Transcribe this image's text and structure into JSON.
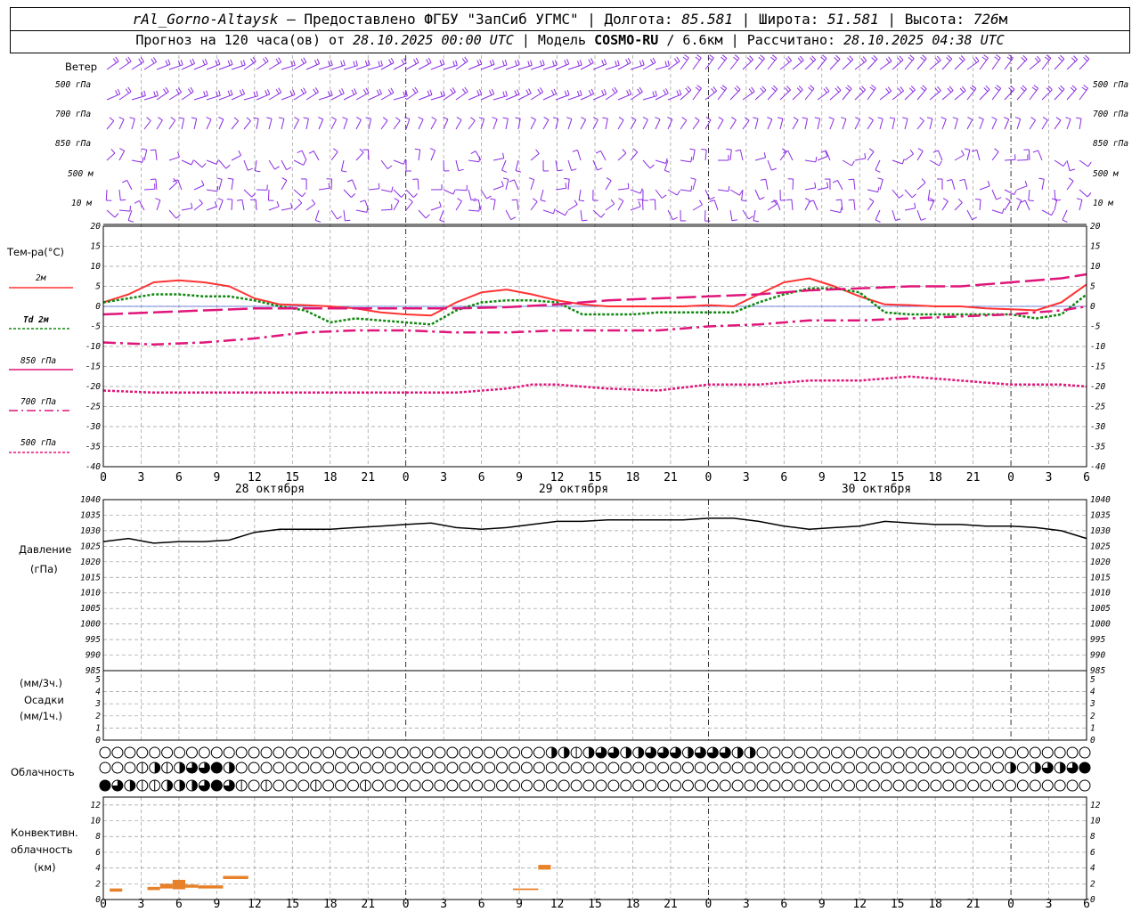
{
  "header": {
    "station": "rAl_Gorno-Altaysk",
    "provider": "Предоставлено ФГБУ \"ЗапСиб УГМС\"",
    "lon_label": "Долгота:",
    "lon_value": "85.581",
    "lat_label": "Широта:",
    "lat_value": "51.581",
    "alt_label": "Высота:",
    "alt_value": "726",
    "alt_unit": "м",
    "forecast_label": "Прогноз на 120 часа(ов) от",
    "forecast_start": "28.10.2025 00:00 UTC",
    "model_label": "Модель",
    "model_name": "COSMO-RU",
    "model_res": "/ 6.6км",
    "computed_label": "Рассчитано:",
    "computed_time": "28.10.2025 04:38 UTC"
  },
  "colors": {
    "wind": "#8a2be2",
    "t2m": "#ff3333",
    "td2m": "#118811",
    "upper": "#e0157a",
    "pressure": "#000000",
    "conv": "#e8822a",
    "grid": "#999999",
    "zero_line": "#4a5fd6"
  },
  "panels": {
    "wind_title": "Ветер",
    "wind_levels": [
      "500 гПа",
      "700 гПа",
      "850 гПа",
      "500 м",
      "10 м"
    ],
    "temp_title": "Тем-ра(°С)",
    "pressure_title": "Давление",
    "pressure_unit": "(гПа)",
    "precip_unit1": "(мм/3ч.)",
    "precip_title": "Осадки",
    "precip_unit2": "(мм/1ч.)",
    "cloud_title": "Облачность",
    "conv_title1": "Конвективн.",
    "conv_title2": "облачность",
    "conv_unit": "(км)",
    "dates": [
      "28 октября",
      "29 октября",
      "30 октября"
    ]
  },
  "chart_data": [
    {
      "type": "line",
      "id": "temperature",
      "ylim": [
        -40,
        20
      ],
      "yticks": [
        20,
        15,
        10,
        5,
        0,
        -5,
        -10,
        -15,
        -20,
        -25,
        -30,
        -35,
        -40
      ],
      "x_hours": [
        0,
        3,
        6,
        9,
        12,
        15,
        18,
        21,
        24,
        27,
        30,
        33,
        36,
        39,
        42,
        45,
        48,
        51,
        54,
        57,
        60,
        63,
        66,
        69,
        72,
        75,
        78
      ],
      "x_tick_labels": [
        "0",
        "3",
        "6",
        "9",
        "12",
        "15",
        "18",
        "21",
        "0",
        "3",
        "6",
        "9",
        "12",
        "15",
        "18",
        "21",
        "0",
        "3",
        "6",
        "9",
        "12",
        "15",
        "18",
        "21",
        "0",
        "3",
        "6"
      ],
      "series": [
        {
          "name": "2м",
          "x": [
            0,
            2,
            4,
            6,
            8,
            10,
            12,
            14,
            16,
            18,
            20,
            22,
            24,
            26,
            28,
            30,
            32,
            34,
            36,
            38,
            40,
            42,
            44,
            46,
            48,
            50,
            52,
            54,
            56,
            58,
            60,
            62,
            64,
            66,
            68,
            70,
            72,
            74,
            76,
            78
          ],
          "y": [
            1,
            3,
            6,
            6.5,
            6,
            5,
            2,
            0.5,
            0.3,
            0,
            -0.5,
            -1.5,
            -2,
            -2.3,
            1,
            3.5,
            4.2,
            3,
            1.5,
            0.5,
            0,
            0,
            0,
            0,
            0.3,
            0,
            3,
            6,
            7,
            5,
            2.5,
            0.5,
            0.3,
            0,
            0,
            -0.5,
            -0.7,
            -1,
            1,
            5.5
          ]
        },
        {
          "name": "Td 2м",
          "x": [
            0,
            2,
            4,
            6,
            8,
            10,
            12,
            14,
            16,
            18,
            20,
            22,
            24,
            26,
            28,
            30,
            32,
            34,
            36,
            38,
            40,
            42,
            44,
            46,
            48,
            50,
            52,
            54,
            56,
            58,
            60,
            62,
            64,
            66,
            68,
            70,
            72,
            74,
            76,
            78
          ],
          "y": [
            1,
            2,
            3,
            3,
            2.5,
            2.5,
            1.5,
            0,
            -1,
            -4,
            -3,
            -3.5,
            -4,
            -4.5,
            -1,
            1,
            1.5,
            1.5,
            1,
            -2,
            -2,
            -2,
            -1.5,
            -1.5,
            -1.5,
            -1.5,
            1,
            3,
            4.5,
            4.5,
            3.5,
            -1.5,
            -2,
            -2,
            -2,
            -2,
            -2,
            -3,
            -2,
            3
          ]
        },
        {
          "name": "850 гПа",
          "x": [
            0,
            4,
            8,
            12,
            16,
            20,
            24,
            28,
            32,
            36,
            40,
            44,
            48,
            52,
            56,
            60,
            64,
            68,
            72,
            76,
            78
          ],
          "y": [
            -2,
            -1.5,
            -1,
            -0.5,
            -0.5,
            -0.5,
            -0.5,
            -0.5,
            -0.2,
            0.5,
            1.5,
            2,
            2.5,
            3,
            4,
            4.5,
            5,
            5,
            6,
            7,
            8
          ]
        },
        {
          "name": "700 гПа",
          "x": [
            0,
            4,
            8,
            12,
            16,
            20,
            24,
            28,
            32,
            36,
            40,
            44,
            48,
            52,
            56,
            60,
            64,
            68,
            72,
            76,
            78
          ],
          "y": [
            -9,
            -9.5,
            -9,
            -8,
            -6.5,
            -6,
            -6,
            -6.5,
            -6.5,
            -6,
            -6,
            -6,
            -5,
            -4.5,
            -3.5,
            -3.5,
            -3,
            -2.5,
            -2,
            -1,
            0
          ]
        },
        {
          "name": "500 гПа",
          "x": [
            0,
            4,
            8,
            12,
            16,
            20,
            24,
            28,
            32,
            34,
            36,
            40,
            44,
            48,
            52,
            56,
            60,
            64,
            68,
            72,
            76,
            78
          ],
          "y": [
            -21,
            -21.5,
            -21.5,
            -21.5,
            -21.5,
            -21.5,
            -21.5,
            -21.5,
            -20.5,
            -19.5,
            -19.5,
            -20.5,
            -21,
            -19.5,
            -19.5,
            -18.5,
            -18.5,
            -17.5,
            -18.5,
            -19.5,
            -19.5,
            -20
          ]
        }
      ]
    },
    {
      "type": "line",
      "id": "pressure",
      "ylim": [
        985,
        1040
      ],
      "yticks": [
        1040,
        1035,
        1030,
        1025,
        1020,
        1015,
        1010,
        1005,
        1000,
        995,
        990,
        985
      ],
      "x": [
        0,
        2,
        4,
        6,
        8,
        10,
        12,
        14,
        16,
        18,
        20,
        22,
        24,
        26,
        28,
        30,
        32,
        34,
        36,
        38,
        40,
        42,
        44,
        46,
        48,
        50,
        52,
        54,
        56,
        58,
        60,
        62,
        64,
        66,
        68,
        70,
        72,
        74,
        76,
        78
      ],
      "series": [
        {
          "name": "",
          "y": [
            1026.5,
            1027.5,
            1026,
            1026.5,
            1026.5,
            1027,
            1029.5,
            1030.5,
            1030.5,
            1030.5,
            1031,
            1031.5,
            1032,
            1032.5,
            1031,
            1030.5,
            1031,
            1032,
            1033,
            1033,
            1033.5,
            1033.5,
            1033.5,
            1033.5,
            1034,
            1034,
            1033,
            1031.5,
            1030.5,
            1031,
            1031.5,
            1033,
            1032.5,
            1032,
            1032,
            1031.5,
            1031.5,
            1031,
            1030,
            1027.5
          ]
        }
      ]
    },
    {
      "type": "bar",
      "id": "precipitation",
      "ylim": [
        0,
        5
      ],
      "yticks": [
        5,
        4,
        3,
        2,
        1,
        0
      ],
      "values": []
    },
    {
      "type": "heatmap",
      "id": "cloudiness",
      "rows": 3,
      "columns": 80,
      "note": "clear",
      "values": [
        [
          0,
          0,
          0,
          0,
          0,
          0,
          0,
          0,
          0,
          0,
          0,
          0,
          0,
          0,
          0,
          0,
          0,
          0,
          0,
          0,
          0,
          0,
          0,
          0,
          0,
          0,
          0,
          0,
          0,
          0,
          0,
          0,
          0,
          0,
          0,
          0,
          2,
          2,
          1,
          2,
          3,
          3,
          2,
          2,
          3,
          3,
          3,
          2,
          3,
          3,
          3,
          2,
          2,
          0,
          0,
          0,
          0,
          0,
          0,
          0,
          0,
          0,
          0,
          0,
          0,
          0,
          0,
          0,
          0,
          0,
          0,
          0,
          0,
          0,
          0,
          0,
          0,
          0,
          0,
          0
        ],
        [
          0,
          0,
          0,
          1,
          2,
          1,
          2,
          3,
          3,
          4,
          2,
          0,
          0,
          0,
          0,
          0,
          0,
          0,
          0,
          0,
          0,
          0,
          0,
          0,
          0,
          0,
          0,
          0,
          0,
          0,
          0,
          0,
          0,
          0,
          0,
          0,
          0,
          0,
          0,
          0,
          0,
          0,
          0,
          0,
          0,
          0,
          0,
          0,
          0,
          0,
          0,
          0,
          0,
          0,
          0,
          0,
          0,
          0,
          0,
          0,
          0,
          0,
          0,
          0,
          0,
          0,
          0,
          0,
          0,
          0,
          0,
          0,
          0,
          2,
          0,
          2,
          3,
          2,
          3,
          4
        ],
        [
          4,
          3,
          2,
          1,
          1,
          2,
          2,
          2,
          3,
          4,
          3,
          1,
          0,
          1,
          0,
          0,
          0,
          1,
          0,
          0,
          0,
          1,
          0,
          0,
          0,
          0,
          0,
          0,
          0,
          0,
          0,
          0,
          0,
          0,
          0,
          0,
          0,
          0,
          0,
          0,
          0,
          0,
          0,
          0,
          0,
          0,
          0,
          0,
          0,
          0,
          0,
          0,
          0,
          0,
          0,
          0,
          0,
          0,
          0,
          0,
          0,
          0,
          0,
          0,
          0,
          0,
          0,
          0,
          0,
          0,
          0,
          0,
          0,
          0,
          0,
          0,
          0,
          0,
          0,
          0
        ]
      ]
    },
    {
      "type": "bar",
      "id": "convective_cloud",
      "ylim": [
        0,
        13
      ],
      "yticks": [
        12,
        10,
        8,
        6,
        4,
        2,
        0
      ],
      "bars": [
        {
          "x0": 0.5,
          "x1": 1.5,
          "ybottom": 1.0,
          "ytop": 1.4
        },
        {
          "x0": 3.5,
          "x1": 4.5,
          "ybottom": 1.2,
          "ytop": 1.6
        },
        {
          "x0": 4.5,
          "x1": 5.5,
          "ybottom": 1.4,
          "ytop": 2.0
        },
        {
          "x0": 5.5,
          "x1": 6.5,
          "ybottom": 1.3,
          "ytop": 2.5
        },
        {
          "x0": 6.5,
          "x1": 7.5,
          "ybottom": 1.5,
          "ytop": 1.9
        },
        {
          "x0": 7.5,
          "x1": 9.5,
          "ybottom": 1.4,
          "ytop": 1.8
        },
        {
          "x0": 9.5,
          "x1": 11.5,
          "ybottom": 2.6,
          "ytop": 3.0
        },
        {
          "x0": 32.5,
          "x1": 34.5,
          "ybottom": 1.2,
          "ytop": 1.4
        },
        {
          "x0": 34.5,
          "x1": 35.5,
          "ybottom": 3.8,
          "ytop": 4.4
        }
      ]
    }
  ]
}
